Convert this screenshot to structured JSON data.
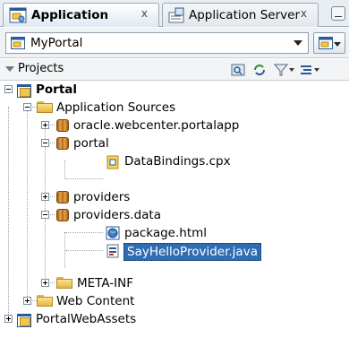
{
  "tabs": [
    {
      "label": "Application",
      "active": true,
      "icon": "application-navigator-icon",
      "close": "x"
    },
    {
      "label": "Application Server",
      "active": false,
      "icon": "application-server-icon",
      "close": "x"
    }
  ],
  "app_selector": {
    "value": "MyPortal",
    "icon": "application-icon"
  },
  "projects": {
    "label": "Projects",
    "toolbar_icons": [
      "find-icon",
      "refresh-icon",
      "filter-icon",
      "sort-icon"
    ]
  },
  "tree": {
    "portal": "Portal",
    "application_sources": "Application Sources",
    "oracle_pkg": "oracle.webcenter.portalapp",
    "portal_pkg": "portal",
    "databindings": "DataBindings.cpx",
    "providers": "providers",
    "providers_data": "providers.data",
    "package_html": "package.html",
    "sayhello": "SayHelloProvider.java",
    "meta_inf": "META-INF",
    "web_content": "Web Content",
    "portal_web_assets": "PortalWebAssets"
  },
  "colors": {
    "selection": "#2f6db3",
    "tab_bg": "#e9eef3"
  }
}
